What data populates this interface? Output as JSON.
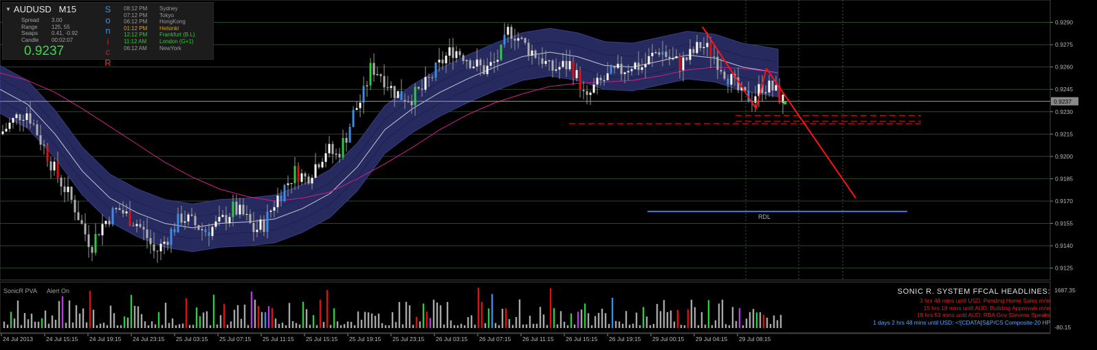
{
  "symbol": "AUDUSD",
  "timeframe": "M15",
  "stats": [
    {
      "label": "Spread",
      "value": "3.00"
    },
    {
      "label": "Range",
      "value": "125, 55"
    },
    {
      "label": "Swaps",
      "value": "0.41, -0.92"
    },
    {
      "label": "Candle",
      "value": "00:02:07"
    }
  ],
  "current_price": "0.9237",
  "sonic_letters": [
    {
      "ch": "S",
      "color": "#3a8ee6"
    },
    {
      "ch": "o",
      "color": "#3a8ee6"
    },
    {
      "ch": "n",
      "color": "#3a8ee6"
    },
    {
      "ch": "i",
      "color": "#d02020"
    },
    {
      "ch": "c",
      "color": "#d02020"
    },
    {
      "ch": "R",
      "color": "#ff2a2a"
    }
  ],
  "sessions": [
    {
      "time": "08:12 PM",
      "city": "Sydney",
      "color": "#9a9a9a"
    },
    {
      "time": "07:12 PM",
      "city": "Tokyo",
      "color": "#9a9a9a"
    },
    {
      "time": "06:12 PM",
      "city": "HongKong",
      "color": "#9a9a9a"
    },
    {
      "time": "01:12 PM",
      "city": "Helsinki",
      "color": "#e0a020"
    },
    {
      "time": "12:12 PM",
      "city": "Frankfurt (B.L)",
      "color": "#39c43a"
    },
    {
      "time": "11:12 AM",
      "city": "London (G+1)",
      "color": "#39c43a"
    },
    {
      "time": "06:12 AM",
      "city": "NewYork",
      "color": "#9a9a9a"
    }
  ],
  "colors": {
    "bull": "#ffffff",
    "bear": "#b0b0b0",
    "blue_candle": "#3a8ee6",
    "green_candle": "#2ecc40",
    "red_candle": "#e01010",
    "band": "#262a5e",
    "ma": "#d31f8a",
    "grid": "#2a4a2a",
    "trend": "#ff1414",
    "rdl": "#3a7fe0"
  },
  "chart_data": {
    "type": "candlestick",
    "symbol": "AUDUSD",
    "timeframe": "M15",
    "ylim": [
      0.9117,
      0.9305
    ],
    "price_ticks": [
      "0.9290",
      "0.9275",
      "0.9260",
      "0.9245",
      "0.9230",
      "0.9215",
      "0.9200",
      "0.9185",
      "0.9170",
      "0.9155",
      "0.9140",
      "0.9125"
    ],
    "current_price": "0.9237",
    "time_labels": [
      "24 Jul 2013",
      "24 Jul 15:15",
      "24 Jul 19:15",
      "24 Jul 23:15",
      "25 Jul 03:15",
      "25 Jul 07:15",
      "25 Jul 11:15",
      "25 Jul 15:15",
      "25 Jul 19:15",
      "25 Jul 23:15",
      "26 Jul 03:15",
      "26 Jul 07:15",
      "26 Jul 11:15",
      "26 Jul 15:15",
      "26 Jul 19:15",
      "29 Jul 00:15",
      "29 Jul 04:15",
      "29 Jul 08:15"
    ],
    "price_path": [
      [
        0,
        0.9215
      ],
      [
        15,
        0.9222
      ],
      [
        28,
        0.9228
      ],
      [
        40,
        0.923
      ],
      [
        55,
        0.9215
      ],
      [
        70,
        0.92
      ],
      [
        82,
        0.9188
      ],
      [
        95,
        0.9178
      ],
      [
        110,
        0.9165
      ],
      [
        122,
        0.915
      ],
      [
        133,
        0.914
      ],
      [
        145,
        0.9152
      ],
      [
        160,
        0.916
      ],
      [
        172,
        0.9165
      ],
      [
        185,
        0.916
      ],
      [
        200,
        0.9155
      ],
      [
        215,
        0.9145
      ],
      [
        225,
        0.9135
      ],
      [
        235,
        0.914
      ],
      [
        250,
        0.915
      ],
      [
        265,
        0.916
      ],
      [
        280,
        0.9155
      ],
      [
        300,
        0.915
      ],
      [
        320,
        0.9155
      ],
      [
        340,
        0.9165
      ],
      [
        355,
        0.916
      ],
      [
        370,
        0.915
      ],
      [
        385,
        0.9155
      ],
      [
        400,
        0.917
      ],
      [
        415,
        0.918
      ],
      [
        430,
        0.919
      ],
      [
        445,
        0.9185
      ],
      [
        460,
        0.9195
      ],
      [
        475,
        0.9205
      ],
      [
        490,
        0.92
      ],
      [
        505,
        0.9215
      ],
      [
        515,
        0.923
      ],
      [
        528,
        0.924
      ],
      [
        540,
        0.926
      ],
      [
        555,
        0.9255
      ],
      [
        570,
        0.9245
      ],
      [
        585,
        0.924
      ],
      [
        600,
        0.924
      ],
      [
        615,
        0.9245
      ],
      [
        630,
        0.9255
      ],
      [
        645,
        0.9265
      ],
      [
        660,
        0.9272
      ],
      [
        675,
        0.9268
      ],
      [
        690,
        0.9262
      ],
      [
        705,
        0.9258
      ],
      [
        718,
        0.9262
      ],
      [
        730,
        0.927
      ],
      [
        740,
        0.9285
      ],
      [
        750,
        0.9282
      ],
      [
        762,
        0.9275
      ],
      [
        775,
        0.927
      ],
      [
        790,
        0.9265
      ],
      [
        800,
        0.9258
      ],
      [
        815,
        0.926
      ],
      [
        830,
        0.9262
      ],
      [
        845,
        0.9248
      ],
      [
        852,
        0.9235
      ],
      [
        862,
        0.9245
      ],
      [
        875,
        0.925
      ],
      [
        890,
        0.9255
      ],
      [
        905,
        0.9258
      ],
      [
        920,
        0.9262
      ],
      [
        935,
        0.926
      ],
      [
        950,
        0.9268
      ],
      [
        960,
        0.9272
      ],
      [
        975,
        0.9265
      ],
      [
        990,
        0.9262
      ],
      [
        1005,
        0.9268
      ],
      [
        1020,
        0.9275
      ],
      [
        1035,
        0.927
      ],
      [
        1050,
        0.926
      ],
      [
        1065,
        0.925
      ],
      [
        1080,
        0.924
      ],
      [
        1095,
        0.924
      ],
      [
        1110,
        0.9248
      ],
      [
        1125,
        0.9245
      ],
      [
        1140,
        0.9237
      ]
    ],
    "sonic_band_center": [
      [
        0,
        0.9245
      ],
      [
        40,
        0.9235
      ],
      [
        80,
        0.9215
      ],
      [
        120,
        0.919
      ],
      [
        160,
        0.9172
      ],
      [
        200,
        0.9162
      ],
      [
        240,
        0.9155
      ],
      [
        280,
        0.9152
      ],
      [
        320,
        0.9155
      ],
      [
        360,
        0.9156
      ],
      [
        400,
        0.9158
      ],
      [
        440,
        0.9165
      ],
      [
        480,
        0.9175
      ],
      [
        520,
        0.9193
      ],
      [
        560,
        0.9218
      ],
      [
        600,
        0.9232
      ],
      [
        640,
        0.9243
      ],
      [
        680,
        0.9252
      ],
      [
        720,
        0.926
      ],
      [
        760,
        0.9267
      ],
      [
        800,
        0.927
      ],
      [
        840,
        0.9267
      ],
      [
        880,
        0.9261
      ],
      [
        920,
        0.926
      ],
      [
        960,
        0.9264
      ],
      [
        1000,
        0.9268
      ],
      [
        1040,
        0.9266
      ],
      [
        1080,
        0.926
      ],
      [
        1120,
        0.9257
      ],
      [
        1132,
        0.9256
      ]
    ],
    "ma_line": [
      [
        0,
        0.9256
      ],
      [
        40,
        0.9251
      ],
      [
        80,
        0.9243
      ],
      [
        120,
        0.9232
      ],
      [
        160,
        0.922
      ],
      [
        200,
        0.9208
      ],
      [
        240,
        0.9196
      ],
      [
        280,
        0.9186
      ],
      [
        320,
        0.9178
      ],
      [
        360,
        0.9173
      ],
      [
        400,
        0.917
      ],
      [
        440,
        0.9172
      ],
      [
        480,
        0.9176
      ],
      [
        520,
        0.9185
      ],
      [
        560,
        0.9195
      ],
      [
        600,
        0.9206
      ],
      [
        640,
        0.9218
      ],
      [
        680,
        0.9228
      ],
      [
        720,
        0.9236
      ],
      [
        760,
        0.9242
      ],
      [
        800,
        0.9247
      ],
      [
        840,
        0.9249
      ],
      [
        880,
        0.925
      ],
      [
        920,
        0.9251
      ],
      [
        960,
        0.9254
      ],
      [
        1000,
        0.9258
      ],
      [
        1040,
        0.926
      ],
      [
        1080,
        0.9259
      ],
      [
        1120,
        0.9257
      ],
      [
        1132,
        0.9256
      ]
    ],
    "trend_lines": [
      {
        "from": [
          1022,
          0.9287
        ],
        "to": [
          1100,
          0.9232
        ]
      },
      {
        "from": [
          1100,
          0.9232
        ],
        "to": [
          1115,
          0.9259
        ]
      },
      {
        "from": [
          1115,
          0.9259
        ],
        "to": [
          1245,
          0.9172
        ]
      }
    ],
    "dashed_levels": [
      {
        "from": 1070,
        "to": 1340,
        "price": 0.92275
      },
      {
        "from": 1070,
        "to": 1340,
        "price": 0.92235
      },
      {
        "from": 828,
        "to": 1340,
        "price": 0.9222
      }
    ],
    "rdl_line": {
      "label": "RDL",
      "from": 942,
      "to": 1320,
      "price": 0.9163
    },
    "vertical_guides": [
      1085,
      1162,
      1226
    ],
    "volume": {
      "indicator": "SonicR PVA",
      "alert": "Alert On",
      "axis_top": "1687.35",
      "axis_bottom": "-80.15"
    }
  },
  "pva": {
    "name": "SonicR PVA",
    "alert": "Alert On"
  },
  "headlines": {
    "title": "SONIC R. SYSTEM  FFCAL HEADLINES:",
    "lines": [
      {
        "text": "3 hrs 48 mins until USD: Pending Home Sales m/m",
        "color": "#e02020"
      },
      {
        "text": "15 hrs 18 mins until AUD: Building Approvals m/m",
        "color": "#e02020"
      },
      {
        "text": "18 hrs 53 mins until AUD: RBA Gov Stevens Speaks",
        "color": "#e02020"
      },
      {
        "text": "1 days 2 hrs 48 mins until USD: <![CDATA[S&P/CS Composite-20 HP",
        "color": "#5aa8ff"
      }
    ]
  }
}
